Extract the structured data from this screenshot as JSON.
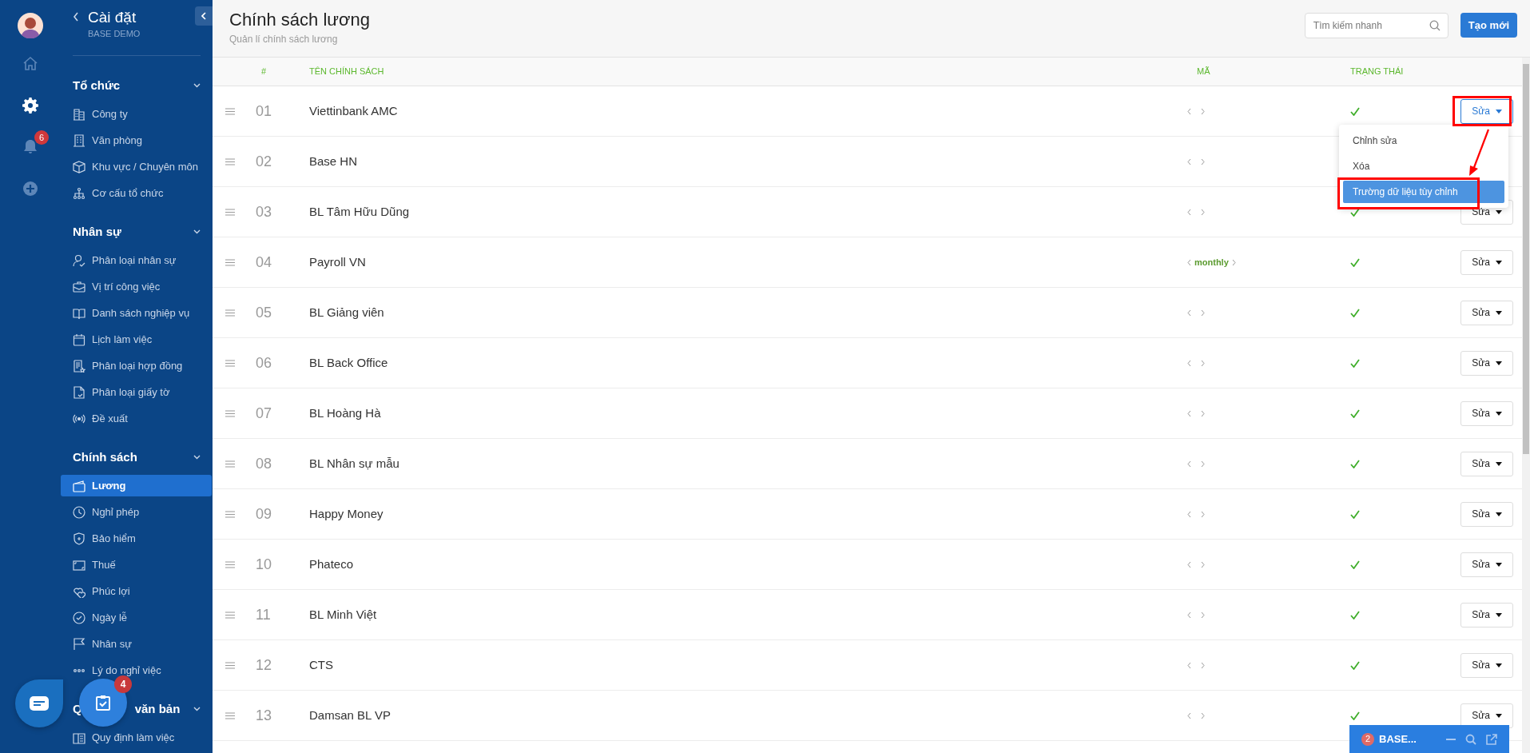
{
  "rail": {
    "items": [
      {
        "kind": "home",
        "selected": false
      },
      {
        "kind": "settings",
        "selected": true
      },
      {
        "kind": "bell",
        "selected": false,
        "badge": "6"
      },
      {
        "kind": "add",
        "selected": false
      }
    ]
  },
  "sidebar": {
    "title": "Cài đặt",
    "subtitle": "BASE DEMO",
    "sections": [
      {
        "title": "Tổ chức",
        "expanded": true,
        "items": [
          {
            "label": "Công ty",
            "selected": false
          },
          {
            "label": "Văn phòng",
            "selected": false
          },
          {
            "label": "Khu vực / Chuyên môn",
            "selected": false
          },
          {
            "label": "Cơ cấu tổ chức",
            "selected": false
          }
        ]
      },
      {
        "title": "Nhân sự",
        "expanded": true,
        "items": [
          {
            "label": "Phân loại nhân sự",
            "selected": false
          },
          {
            "label": "Vị trí công việc",
            "selected": false
          },
          {
            "label": "Danh sách nghiệp vụ",
            "selected": false
          },
          {
            "label": "Lịch làm việc",
            "selected": false
          },
          {
            "label": "Phân loại hợp đồng",
            "selected": false
          },
          {
            "label": "Phân loại giấy tờ",
            "selected": false
          },
          {
            "label": "Đề xuất",
            "selected": false
          }
        ]
      },
      {
        "title": "Chính sách",
        "expanded": true,
        "items": [
          {
            "label": "Lương",
            "selected": true
          },
          {
            "label": "Nghỉ phép",
            "selected": false
          },
          {
            "label": "Bảo hiểm",
            "selected": false
          },
          {
            "label": "Thuế",
            "selected": false
          },
          {
            "label": "Phúc lợi",
            "selected": false
          },
          {
            "label": "Ngày lễ",
            "selected": false
          },
          {
            "label": "Nhân sự",
            "selected": false
          },
          {
            "label": "Lý do nghỉ việc",
            "selected": false
          }
        ]
      },
      {
        "title": "Q",
        "title_tail": "văn bản",
        "expanded": true,
        "items": [
          {
            "label": "Quy định làm việc",
            "selected": false
          }
        ]
      }
    ]
  },
  "header": {
    "title": "Chính sách lương",
    "subtitle": "Quản lí chính sách lương",
    "search": {
      "placeholder": "Tìm kiếm nhanh"
    },
    "create_button": "Tạo mới"
  },
  "table": {
    "columns": [
      "#",
      "TÊN CHÍNH SÁCH",
      "MÃ",
      "TRẠNG THÁI"
    ],
    "rows": [
      {
        "number": "01",
        "name": "Viettinbank AMC",
        "active": true,
        "action": "Sửa",
        "menu_open": true
      },
      {
        "number": "02",
        "name": "Base HN"
      },
      {
        "number": "03",
        "name": "BL Tâm Hữu Dũng",
        "active": true,
        "action": "Sửa",
        "menu_open": false
      },
      {
        "number": "04",
        "name": "Payroll VN",
        "code": "monthly",
        "active": true,
        "action": "Sửa",
        "menu_open": false
      },
      {
        "number": "05",
        "name": "BL Giảng viên",
        "active": true,
        "action": "Sửa",
        "menu_open": false
      },
      {
        "number": "06",
        "name": "BL Back Office",
        "active": true,
        "action": "Sửa",
        "menu_open": false
      },
      {
        "number": "07",
        "name": "BL Hoàng Hà",
        "active": true,
        "action": "Sửa",
        "menu_open": false
      },
      {
        "number": "08",
        "name": "BL Nhân sự mẫu",
        "active": true,
        "action": "Sửa",
        "menu_open": false
      },
      {
        "number": "09",
        "name": "Happy Money",
        "active": true,
        "action": "Sửa",
        "menu_open": false
      },
      {
        "number": "10",
        "name": "Phateco",
        "active": true,
        "action": "Sửa",
        "menu_open": false
      },
      {
        "number": "11",
        "name": "BL Minh Việt",
        "active": true,
        "action": "Sửa",
        "menu_open": false
      },
      {
        "number": "12",
        "name": "CTS",
        "active": true,
        "action": "Sửa",
        "menu_open": false
      },
      {
        "number": "13",
        "name": "Damsan BL VP",
        "active": true,
        "action": "Sửa",
        "menu_open": false
      }
    ]
  },
  "menu": {
    "annotated": true,
    "items": [
      {
        "label": "Chỉnh sửa",
        "selected": false
      },
      {
        "label": "Xóa",
        "selected": false
      },
      {
        "label": "Trường dữ liệu tùy chỉnh",
        "selected": true
      }
    ]
  },
  "floating": {
    "task_badge": "4"
  },
  "chat_widget": {
    "badge": "2",
    "title": "BASE..."
  }
}
